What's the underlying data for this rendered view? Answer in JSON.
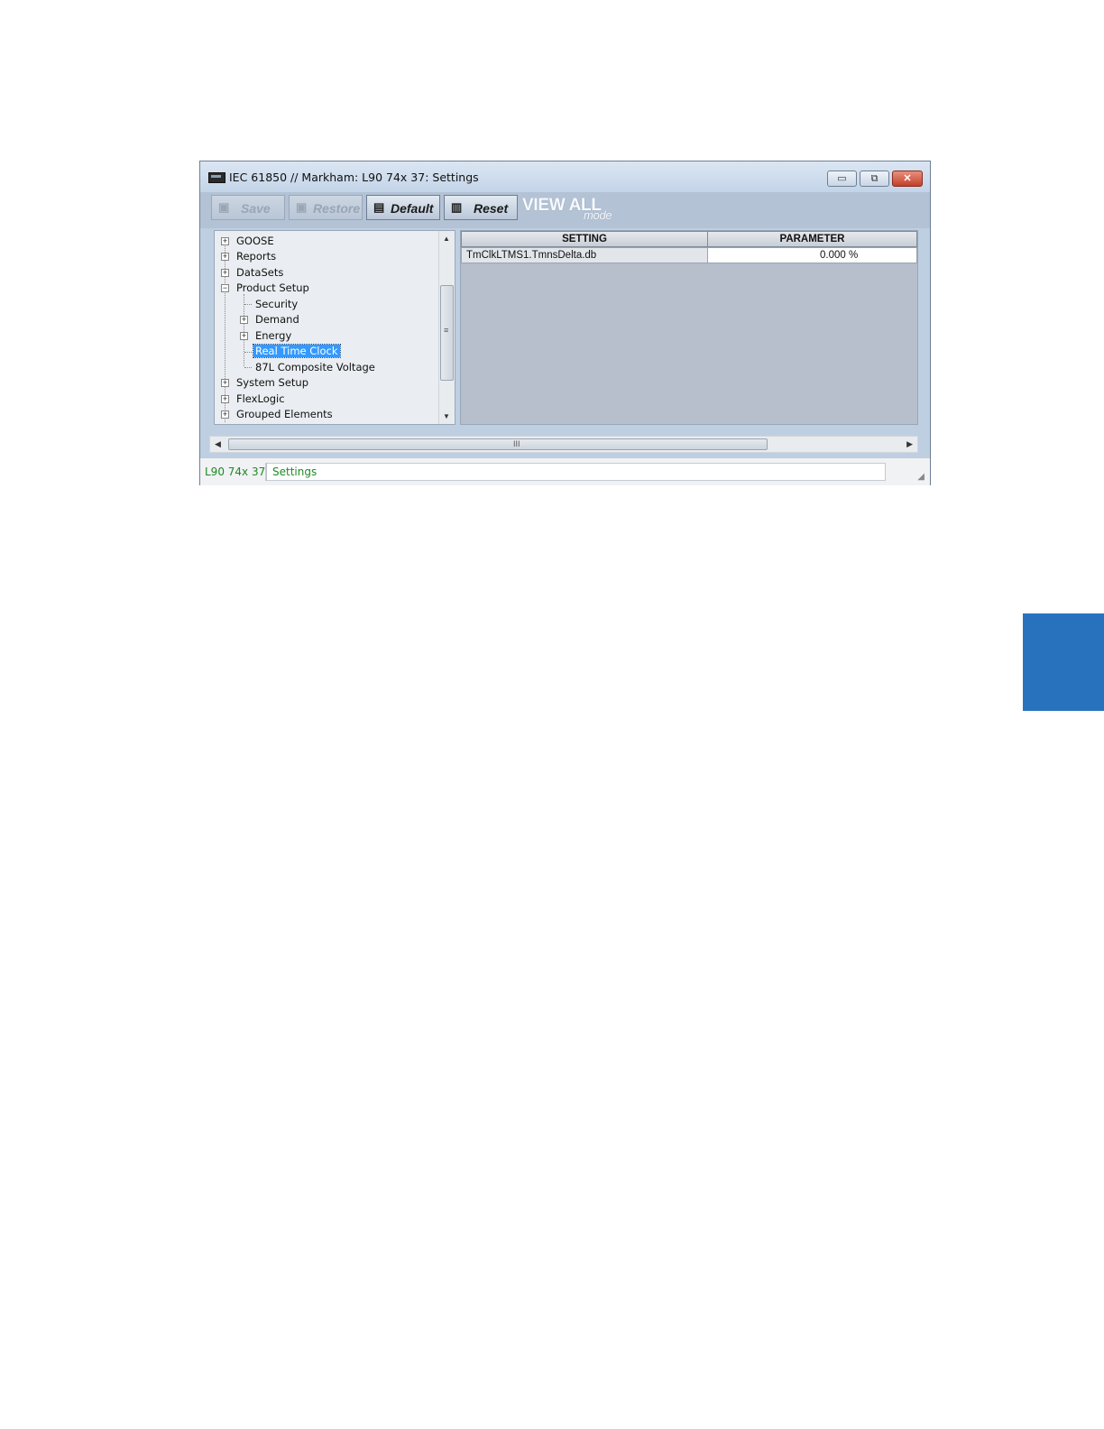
{
  "window": {
    "title": "IEC 61850 // Markham: L90 74x 37: Settings",
    "controls": {
      "minimize": "▭",
      "maximize": "⧉",
      "close": "✕"
    }
  },
  "toolbar": {
    "save_label": "Save",
    "restore_label": "Restore",
    "default_label": "Default",
    "reset_label": "Reset",
    "view_all_label": "VIEW ALL",
    "mode_label": "mode"
  },
  "tree": {
    "items": [
      {
        "label": "GOOSE",
        "expander": "+"
      },
      {
        "label": "Reports",
        "expander": "+"
      },
      {
        "label": "DataSets",
        "expander": "+"
      },
      {
        "label": "Product Setup",
        "expander": "−"
      },
      {
        "label": "Security"
      },
      {
        "label": "Demand",
        "expander": "+"
      },
      {
        "label": "Energy",
        "expander": "+"
      },
      {
        "label": "Real Time Clock",
        "selected": true
      },
      {
        "label": "87L Composite Voltage"
      },
      {
        "label": "System Setup",
        "expander": "+"
      },
      {
        "label": "FlexLogic",
        "expander": "+"
      },
      {
        "label": "Grouped Elements",
        "expander": "+"
      }
    ]
  },
  "grid": {
    "columns": [
      "SETTING",
      "PARAMETER"
    ],
    "rows": [
      {
        "setting": "TmClkLTMS1.TmnsDelta.db",
        "parameter": "0.000 %"
      }
    ]
  },
  "scroll_grip": "III",
  "status": {
    "device": "L90 74x 37",
    "section": "Settings"
  },
  "colors": {
    "side_tab": "#2872bd",
    "status_text": "#1f8a25",
    "selection": "#3399ff"
  }
}
